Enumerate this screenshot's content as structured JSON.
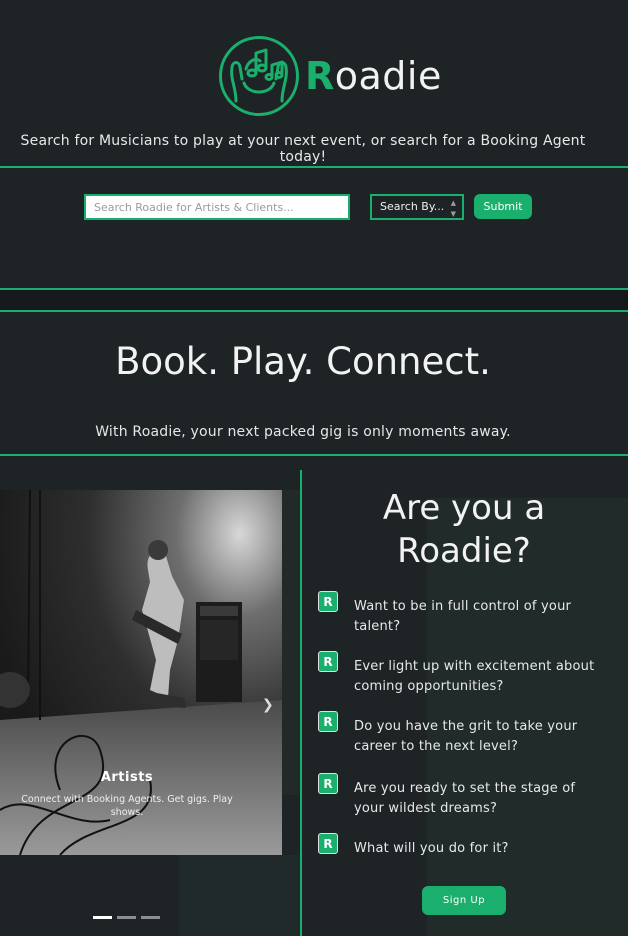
{
  "header": {
    "brand_initial": "R",
    "brand_rest": "oadie",
    "tagline": "Search for Musicians to play at your next event, or search for a Booking Agent today!",
    "logo_icon": "hand-music-notes-icon"
  },
  "search": {
    "placeholder": "Search Roadie for Artists & Clients...",
    "select_label": "Search By...",
    "submit_label": "Submit"
  },
  "hero": {
    "title": "Book. Play. Connect.",
    "subtitle": "With Roadie, your next packed gig is only moments away."
  },
  "carousel": {
    "slide_title": "Artists",
    "slide_text": "Connect with Booking Agents. Get gigs. Play shows.",
    "next_icon": "chevron-right-icon",
    "indicators": [
      true,
      false,
      false
    ]
  },
  "roadie": {
    "question": "Are you a Roadie?",
    "badge_letter": "R",
    "points": [
      "Want to be in full control of your talent?",
      "Ever light up with excitement about coming opportunities?",
      "Do you have the grit to take your career to the next level?",
      "Are you ready to set the stage of your wildest dreams?",
      "What will you do for it?"
    ],
    "signup_label": "Sign Up"
  },
  "colors": {
    "accent": "#1aaf6c",
    "background": "#1e2326"
  }
}
